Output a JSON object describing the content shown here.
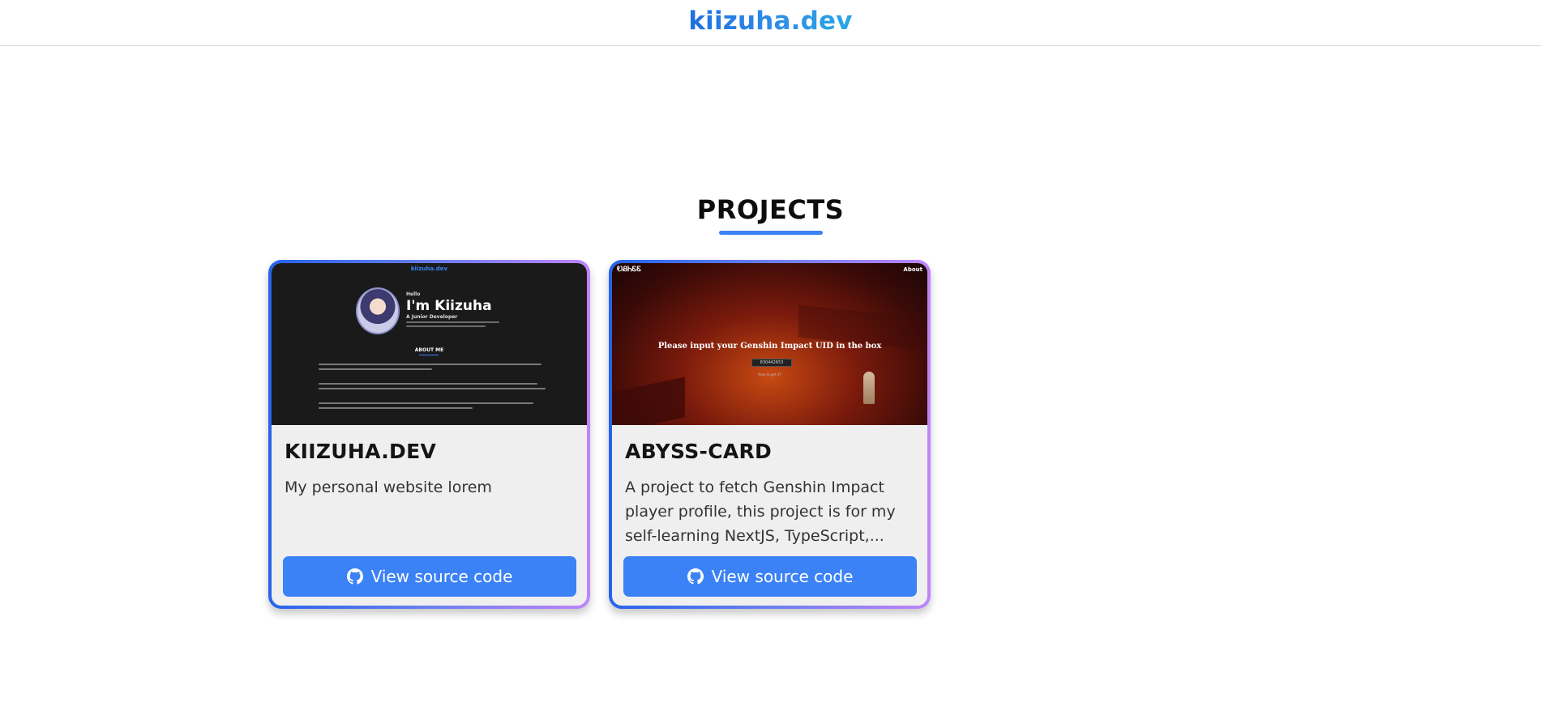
{
  "header": {
    "brand": "kiizuha.dev"
  },
  "projects_section": {
    "title": "PROJECTS"
  },
  "projects": [
    {
      "title": "KIIZUHA.DEV",
      "description": "My personal website lorem",
      "button_label": "View source code",
      "preview": {
        "brand": "kiizuha.dev",
        "hello": "Hello",
        "name": "I'm Kiizuha",
        "role": "A Junior Developer",
        "about_heading": "ABOUT ME"
      }
    },
    {
      "title": "ABYSS-CARD",
      "description": "A project to fetch Genshin Impact player profile, this project is for my self-learning NextJS, TypeScript,...",
      "button_label": "View source code",
      "preview": {
        "logo": "ᎧᏰᏂᏋᏋ",
        "about": "About",
        "prompt": "Please input your Genshin Impact UID in the box",
        "uid_value": "830442653",
        "help_link": "How to get it?"
      }
    }
  ],
  "colors": {
    "accent": "#3b82f6",
    "card_border_start": "#2563eb",
    "card_border_end": "#c084fc"
  },
  "icons": {
    "button_icon": "github-icon"
  }
}
